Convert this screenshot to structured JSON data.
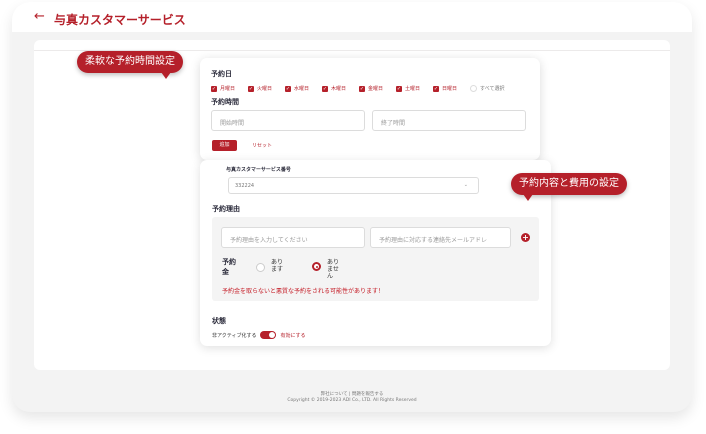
{
  "header": {
    "back_icon": "arrow-left-icon",
    "title": "与真カスタマーサービス"
  },
  "schedule": {
    "day_label": "予約日",
    "days": [
      "月曜日",
      "火曜日",
      "水曜日",
      "木曜日",
      "金曜日",
      "土曜日",
      "日曜日"
    ],
    "select_all": "すべて選択",
    "time_label": "予約時間",
    "start_placeholder": "開始時間",
    "end_placeholder": "終了時間",
    "add_button": "追加",
    "reset_button": "リセット"
  },
  "service": {
    "label": "与真カスタマーサービス番号",
    "value": "332224"
  },
  "reason": {
    "label": "予約理由",
    "reason_placeholder": "予約理由を入力してください",
    "email_placeholder": "予約理由に対応する連絡先メールアドレ",
    "fee_label": "予約金",
    "option_yes": "あります",
    "option_no": "ありません",
    "selected": "ありません",
    "warning": "予約金を取らないと悪質な予約をされる可能性があります！"
  },
  "status": {
    "label": "状態",
    "inactive_label": "非アクティブ化する",
    "active_label": "有効にする",
    "enabled": true
  },
  "callouts": {
    "flexible_time": "柔軟な予約時間設定",
    "content_fee": "予約内容と費用の設定"
  },
  "footer": {
    "links": "弊社について | 問題を報告する",
    "copyright": "Copyright © 2019-2023 ADI Co., LTD. All Rights Reserved"
  },
  "colors": {
    "accent": "#b5202a",
    "background": "#f3f3f3"
  }
}
